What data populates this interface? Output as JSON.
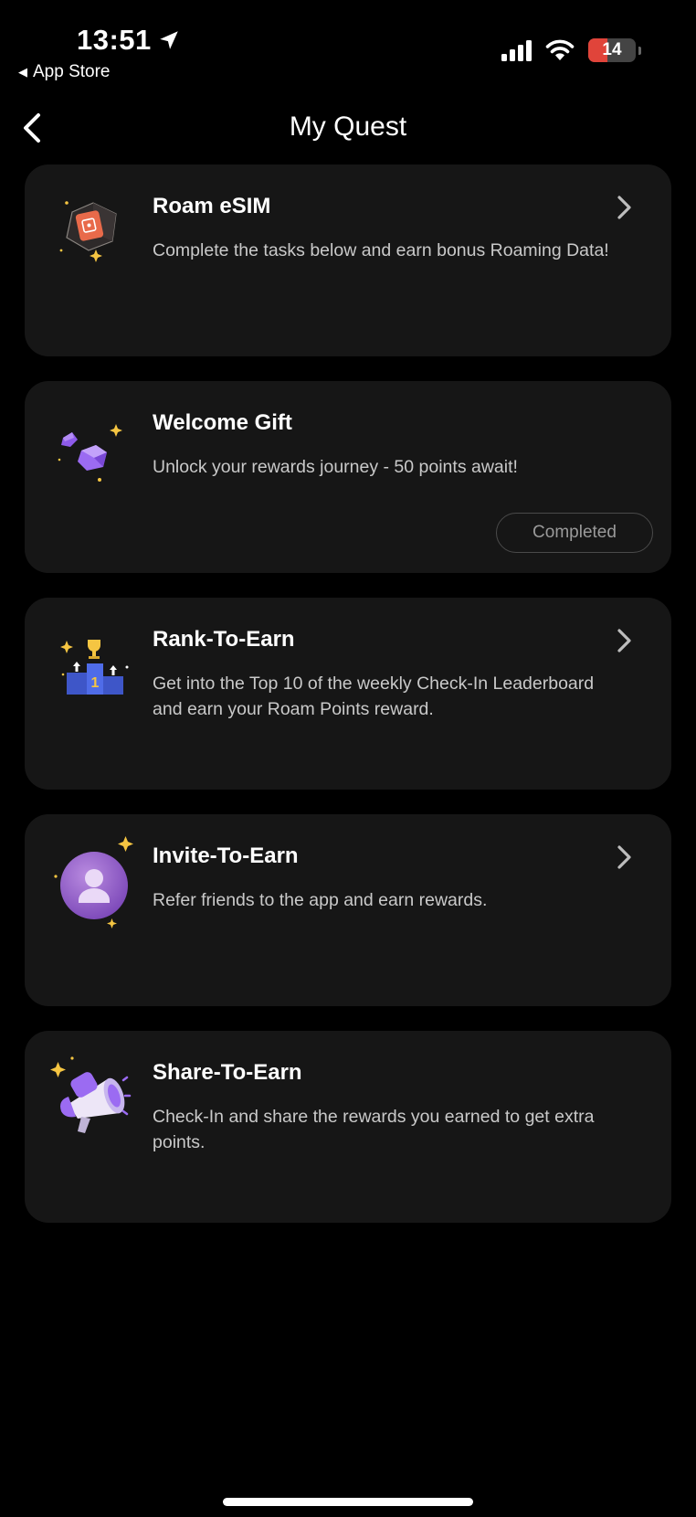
{
  "status_bar": {
    "time": "13:51",
    "back_app": "App Store",
    "battery_level": "14",
    "battery_color": "#E0443A"
  },
  "header": {
    "title": "My Quest"
  },
  "quests": [
    {
      "title": "Roam eSIM",
      "description": "Complete the tasks below and earn bonus Roaming Data!",
      "icon": "sim-card-icon",
      "has_chevron": true
    },
    {
      "title": "Welcome Gift",
      "description": "Unlock your rewards journey - 50 points await!",
      "icon": "gem-icon",
      "status": "Completed"
    },
    {
      "title": "Rank-To-Earn",
      "description": "Get into the Top 10 of the weekly Check-In Leaderboard and earn your Roam Points reward.",
      "icon": "podium-trophy-icon",
      "has_chevron": true
    },
    {
      "title": "Invite-To-Earn",
      "description": "Refer friends to the app and earn rewards.",
      "icon": "user-avatar-icon",
      "has_chevron": true
    },
    {
      "title": "Share-To-Earn",
      "description": "Check-In and share the rewards you earned to get extra points.",
      "icon": "megaphone-icon",
      "has_chevron": false
    }
  ],
  "colors": {
    "background": "#000000",
    "card": "#161616",
    "accent_purple": "#9B6BF2",
    "sparkle": "#F5C542",
    "sim_orange": "#E86A4A"
  }
}
